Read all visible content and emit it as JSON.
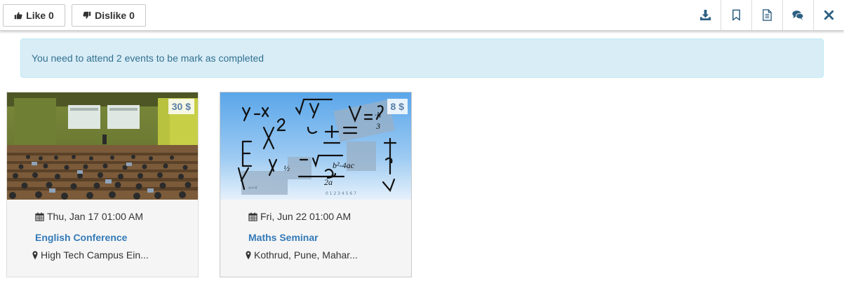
{
  "toolbar": {
    "like_label": "Like 0",
    "dislike_label": "Dislike 0",
    "icons": [
      "download-icon",
      "bookmark-icon",
      "document-icon",
      "comments-icon",
      "close-icon"
    ]
  },
  "alert": {
    "message": "You need to attend 2 events to be mark as completed"
  },
  "events": [
    {
      "price": "30 $",
      "date": "Thu, Jan 17 01:00 AM",
      "title": "English Conference",
      "location": "High Tech Campus Ein..."
    },
    {
      "price": "8 $",
      "date": "Fri, Jun 22 01:00 AM",
      "title": "Maths Seminar",
      "location": "Kothrud, Pune, Mahar..."
    }
  ],
  "colors": {
    "link": "#337ab7",
    "alert_bg": "#d9edf7",
    "alert_text": "#31708f",
    "icon": "#2d5f82"
  }
}
